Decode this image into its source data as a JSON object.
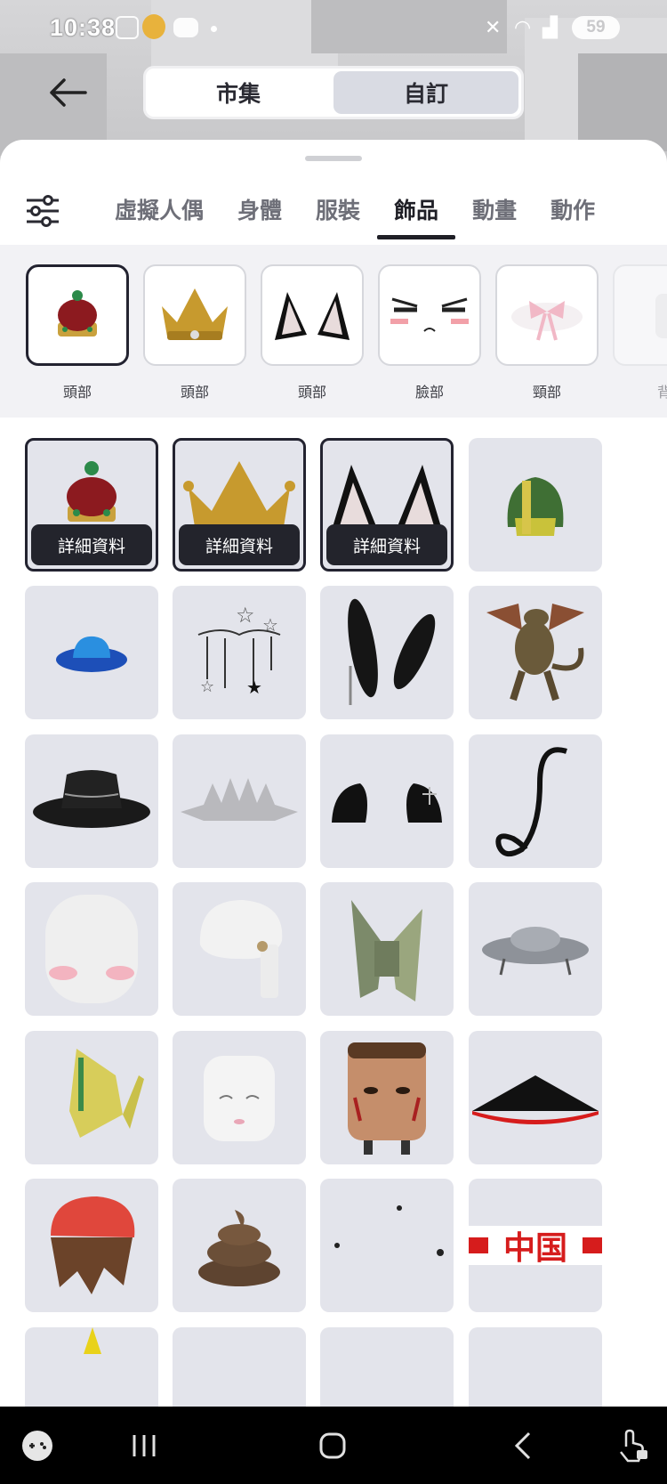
{
  "status_bar": {
    "time": "10:38",
    "battery": "59"
  },
  "header": {
    "segments": [
      {
        "label": "市集",
        "active": false
      },
      {
        "label": "自訂",
        "active": true
      }
    ]
  },
  "tabs": [
    {
      "label": "虛擬人偶",
      "active": false
    },
    {
      "label": "身體",
      "active": false
    },
    {
      "label": "服裝",
      "active": false
    },
    {
      "label": "飾品",
      "active": true
    },
    {
      "label": "動畫",
      "active": false
    },
    {
      "label": "動作",
      "active": false
    }
  ],
  "equipped": [
    {
      "label": "頭部",
      "icon": "crown-red-icon",
      "selected": true
    },
    {
      "label": "頭部",
      "icon": "gold-crown-icon",
      "selected": false
    },
    {
      "label": "頭部",
      "icon": "cat-ears-icon",
      "selected": false
    },
    {
      "label": "臉部",
      "icon": "blush-face-icon",
      "selected": false
    },
    {
      "label": "頸部",
      "icon": "pink-bow-icon",
      "selected": false
    },
    {
      "label": "背",
      "icon": "back-item-icon",
      "selected": false
    }
  ],
  "grid": {
    "detail_label": "詳細資料",
    "items": [
      {
        "icon": "crown-red-icon",
        "selected": true
      },
      {
        "icon": "gold-crown-icon",
        "selected": true
      },
      {
        "icon": "cat-ears-icon",
        "selected": true
      },
      {
        "icon": "green-hood-icon",
        "selected": false
      },
      {
        "icon": "blue-hat-icon",
        "selected": false
      },
      {
        "icon": "star-chains-icon",
        "selected": false
      },
      {
        "icon": "black-bunny-ears-icon",
        "selected": false
      },
      {
        "icon": "dragon-icon",
        "selected": false
      },
      {
        "icon": "black-fedora-icon",
        "selected": false
      },
      {
        "icon": "silver-tiara-icon",
        "selected": false
      },
      {
        "icon": "black-cat-ears-icon",
        "selected": false
      },
      {
        "icon": "black-tail-icon",
        "selected": false
      },
      {
        "icon": "white-blush-head-icon",
        "selected": false
      },
      {
        "icon": "white-turban-icon",
        "selected": false
      },
      {
        "icon": "money-origami-icon",
        "selected": false
      },
      {
        "icon": "ufo-icon",
        "selected": false
      },
      {
        "icon": "yellow-device-icon",
        "selected": false
      },
      {
        "icon": "marshmallow-face-icon",
        "selected": false
      },
      {
        "icon": "face-paint-head-icon",
        "selected": false
      },
      {
        "icon": "conical-hat-icon",
        "selected": false
      },
      {
        "icon": "red-beanie-hair-icon",
        "selected": false
      },
      {
        "icon": "poop-icon",
        "selected": false
      },
      {
        "icon": "flies-icon",
        "selected": false
      },
      {
        "icon": "china-headband-icon",
        "selected": false,
        "text": "中国"
      }
    ]
  },
  "colors": {
    "accent": "#232330",
    "cell_bg": "#e3e4eb",
    "sheet_bg": "#ffffff"
  }
}
